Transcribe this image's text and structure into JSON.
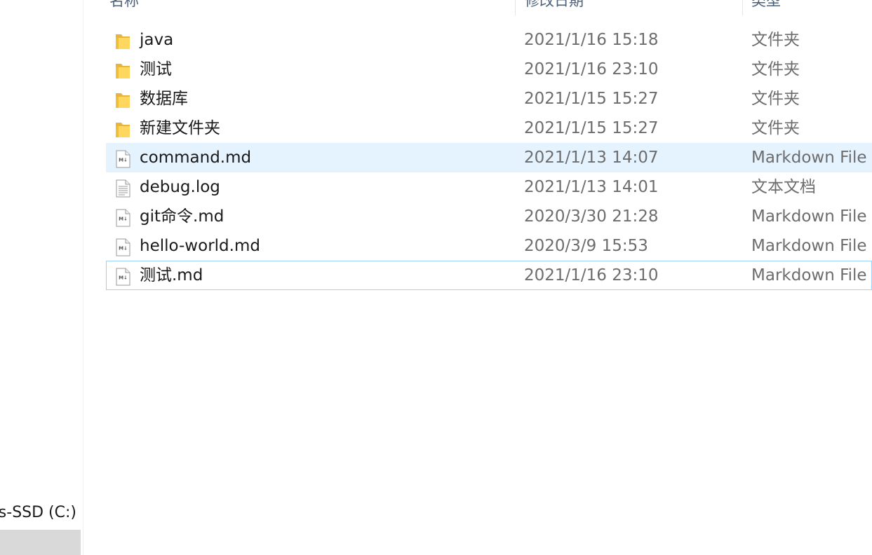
{
  "navigation": {
    "drive_c_label": "s-SSD (C:)",
    "selected_item_label": ")"
  },
  "columns": {
    "name": "名称",
    "date_modified": "修改日期",
    "type": "类型"
  },
  "files": [
    {
      "name": "java",
      "date": "2021/1/16 15:18",
      "type": "文件夹",
      "icon": "folder-icon"
    },
    {
      "name": "测试",
      "date": "2021/1/16 23:10",
      "type": "文件夹",
      "icon": "folder-icon"
    },
    {
      "name": "数据库",
      "date": "2021/1/15 15:27",
      "type": "文件夹",
      "icon": "folder-icon"
    },
    {
      "name": "新建文件夹",
      "date": "2021/1/15 15:27",
      "type": "文件夹",
      "icon": "folder-icon"
    },
    {
      "name": "command.md",
      "date": "2021/1/13 14:07",
      "type": "Markdown File",
      "icon": "markdown-file-icon",
      "state": "hover"
    },
    {
      "name": "debug.log",
      "date": "2021/1/13 14:01",
      "type": "文本文档",
      "icon": "text-file-icon"
    },
    {
      "name": "git命令.md",
      "date": "2020/3/30 21:28",
      "type": "Markdown File",
      "icon": "markdown-file-icon"
    },
    {
      "name": "hello-world.md",
      "date": "2020/3/9 15:53",
      "type": "Markdown File",
      "icon": "markdown-file-icon"
    },
    {
      "name": "测试.md",
      "date": "2021/1/16 23:10",
      "type": "Markdown File",
      "icon": "markdown-file-icon",
      "state": "focused"
    }
  ],
  "colors": {
    "hover_background": "#e5f3ff",
    "focus_border": "#99d1ff",
    "folder_yellow": "#ffd75e",
    "secondary_text": "#6d6d6d"
  }
}
